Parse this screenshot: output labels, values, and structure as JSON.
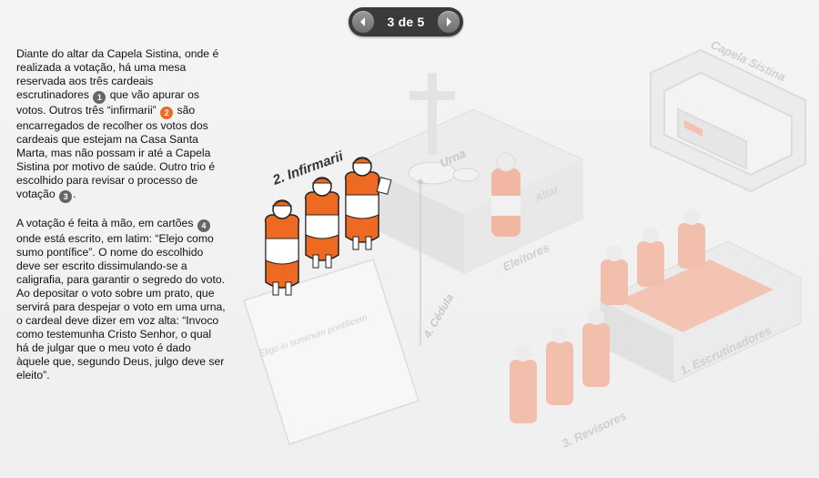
{
  "pager": {
    "counter": "3 de 5",
    "prev_icon": "chevron-left-icon",
    "next_icon": "chevron-right-icon"
  },
  "text": {
    "p1": {
      "a": "Diante do altar da Capela Sistina, onde é realizada a votação, há uma mesa reservada aos três cardeais escrutinadores",
      "badge1": "1",
      "b": "que vão apurar os votos. Outros três “infirmarii”",
      "badge2": "2",
      "c": "são encarregados de recolher os votos dos cardeais que estejam na Casa Santa Marta, mas não possam ir até a Capela Sistina por motivo de saúde. Outro trio é escolhido para revisar o processo de votação",
      "badge3": "3",
      "d": "."
    },
    "p2": {
      "a": "A votação é feita à mão, em cartões",
      "badge4": "4",
      "b": "onde está escrito, em latim: “Elejo como sumo pontífice”. O nome do escolhido deve ser escrito dissimulando-se a caligrafia, para garantir o segredo do voto. Ao depositar o voto sobre um prato, que servirá para despejar o voto em uma urna, o cardeal deve dizer em voz alta: “Invoco como testemunha Cristo Senhor, o qual há de julgar que o meu voto é dado àquele que, segundo Deus, julgo deve ser eleito”."
    }
  },
  "scene_labels": {
    "infirmarii": "2. Infirmarii",
    "urna": "Urna",
    "altar": "Altar",
    "capela": "Capela Sistina",
    "eleitores": "Eleitores",
    "cedula": "4. Cédula",
    "card_text": "Eligo in summum pontificem",
    "escrutinadores": "1. Escrutinadores",
    "revisores": "3. Revisores"
  },
  "colors": {
    "accent": "#ee6a22",
    "badge_dark": "#666666",
    "faded_red": "#f0b9a5",
    "faded_gray": "#d8d8d8"
  }
}
